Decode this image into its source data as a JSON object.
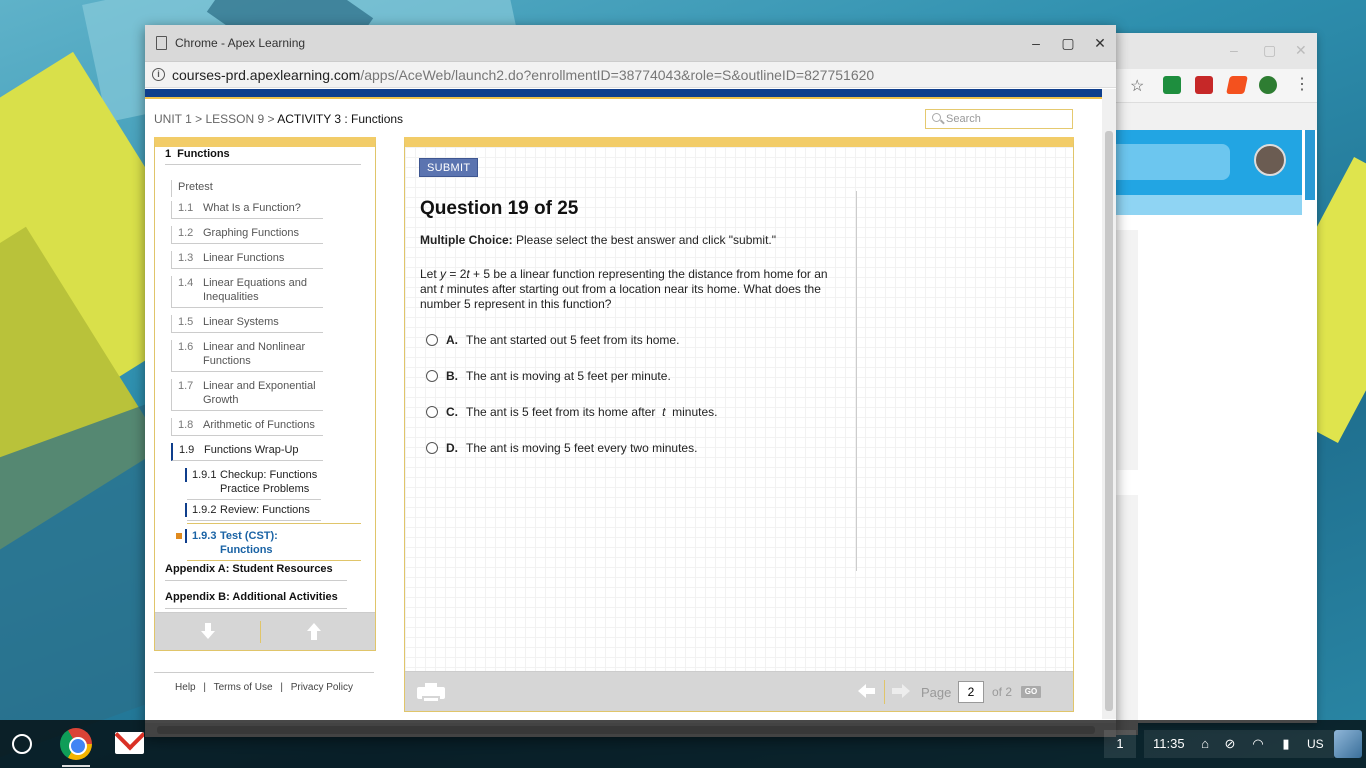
{
  "window": {
    "title": "Chrome - Apex Learning",
    "url_domain": "courses-prd.apexlearning.com",
    "url_path": "/apps/AceWeb/launch2.do?enrollmentID=38774043&role=S&outlineID=827751620",
    "minimize": "–",
    "maximize": "▢",
    "close": "✕"
  },
  "breadcrumb": {
    "unit": "UNIT 1",
    "lesson": "LESSON 9",
    "activity": "ACTIVITY 3 : Functions",
    "sep": ">"
  },
  "search": {
    "placeholder": "Search"
  },
  "sidebar": {
    "unit_number": "1",
    "unit_title": "Functions",
    "pretest": "Pretest",
    "items": [
      {
        "num": "1.1",
        "label": "What Is a Function?"
      },
      {
        "num": "1.2",
        "label": "Graphing Functions"
      },
      {
        "num": "1.3",
        "label": "Linear Functions"
      },
      {
        "num": "1.4",
        "label": "Linear Equations and Inequalities"
      },
      {
        "num": "1.5",
        "label": "Linear Systems"
      },
      {
        "num": "1.6",
        "label": "Linear and Nonlinear Functions"
      },
      {
        "num": "1.7",
        "label": "Linear and Exponential Growth"
      },
      {
        "num": "1.8",
        "label": "Arithmetic of Functions"
      },
      {
        "num": "1.9",
        "label": "Functions Wrap-Up"
      }
    ],
    "subitems": [
      {
        "num": "1.9.1",
        "label": "Checkup: Functions Practice Problems"
      },
      {
        "num": "1.9.2",
        "label": "Review: Functions"
      },
      {
        "num": "1.9.3",
        "label": "Test (CST): Functions"
      }
    ],
    "appendix_a": "Appendix A: Student Resources",
    "appendix_b": "Appendix B: Additional Activities"
  },
  "footer": {
    "help": "Help",
    "terms": "Terms of Use",
    "privacy": "Privacy Policy",
    "sep": "|"
  },
  "question": {
    "submit_label": "SUBMIT",
    "title": "Question 19 of 25",
    "instruction_bold": "Multiple Choice:",
    "instruction": "Please select the best answer and click \"submit.\"",
    "text_part1": "Let ",
    "text_var_y": "y",
    "text_part2": " = 2",
    "text_var_t": "t",
    "text_part3": " + 5 be a linear function representing the distance from home for an ant ",
    "text_var_t2": "t",
    "text_part4": " minutes after starting out from a location near its home. What does the number 5 represent in this function?",
    "choices": [
      {
        "letter": "A.",
        "text": "The ant started out 5 feet from its home."
      },
      {
        "letter": "B.",
        "text": "The ant is moving at 5 feet per minute."
      },
      {
        "letter": "C.",
        "text_a": "The ant is 5 feet from its home after ",
        "text_var": "t",
        "text_b": " minutes."
      },
      {
        "letter": "D.",
        "text": "The ant is moving 5 feet every two minutes."
      }
    ]
  },
  "pager": {
    "page_label": "Page",
    "current_page": "2",
    "of_label": "of 2",
    "go_label": "GO"
  },
  "taskbar": {
    "badge": "1",
    "clock": "11:35",
    "lang": "US"
  }
}
